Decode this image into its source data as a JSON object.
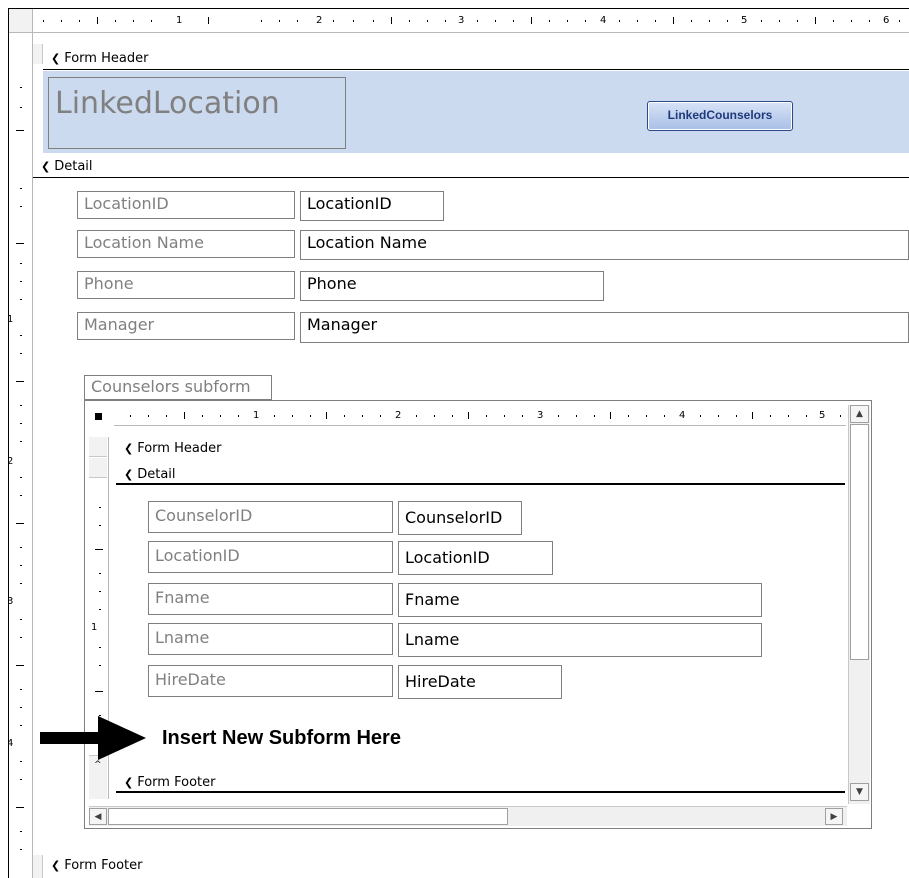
{
  "main_ruler": {
    "marks": [
      "1",
      "2",
      "3",
      "4",
      "5",
      "6"
    ],
    "vmarks": [
      "1",
      "2",
      "3",
      "4"
    ]
  },
  "form_header": {
    "section_label": "Form Header",
    "title": "LinkedLocation",
    "button_label": "LinkedCounselors"
  },
  "detail": {
    "section_label": "Detail",
    "fields": [
      {
        "label": "LocationID",
        "value": "LocationID"
      },
      {
        "label": "Location Name",
        "value": "Location Name"
      },
      {
        "label": "Phone",
        "value": "Phone"
      },
      {
        "label": "Manager",
        "value": "Manager"
      }
    ]
  },
  "subform": {
    "label": "Counselors subform",
    "ruler_marks": [
      "1",
      "2",
      "3",
      "4",
      "5"
    ],
    "vmarks": [
      "1"
    ],
    "header_label": "Form Header",
    "detail_label": "Detail",
    "footer_label": "Form Footer",
    "fields": [
      {
        "label": "CounselorID",
        "value": "CounselorID"
      },
      {
        "label": "LocationID",
        "value": "LocationID"
      },
      {
        "label": "Fname",
        "value": "Fname"
      },
      {
        "label": "Lname",
        "value": "Lname"
      },
      {
        "label": "HireDate",
        "value": "HireDate"
      }
    ]
  },
  "annotation": {
    "text": "Insert New Subform Here"
  },
  "form_footer": {
    "section_label": "Form Footer"
  },
  "icons": {
    "section_toggle": "section-collapse-icon",
    "arrow": "right-arrow-icon"
  }
}
